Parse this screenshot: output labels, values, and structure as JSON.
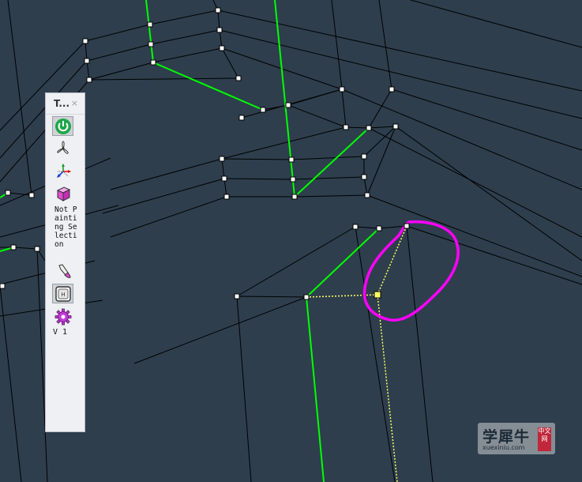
{
  "toolbox": {
    "title": "T...",
    "close_glyph": "×",
    "tools": [
      {
        "name": "power-icon",
        "active": true
      },
      {
        "name": "fan-icon",
        "active": false
      },
      {
        "name": "axis-gizmo-icon",
        "active": false
      },
      {
        "name": "cube-icon",
        "active": false
      }
    ],
    "painting_status": "Not Painting Selection",
    "tools_lower": [
      {
        "name": "pen-icon",
        "active": false
      },
      {
        "name": "keyboard-key-icon",
        "active": true
      },
      {
        "name": "gear-icon",
        "active": false
      }
    ],
    "version": "V 1"
  },
  "colors": {
    "background": "#2e3e4d",
    "wire": "#000000",
    "highlight": "#00ff00",
    "selection_loop": "#ff00ff",
    "selected_vertex": "#ffff66"
  },
  "watermark": {
    "cn_text": "学犀牛",
    "en_text": "xuexiniu.com",
    "stamp_text": "中文网"
  }
}
